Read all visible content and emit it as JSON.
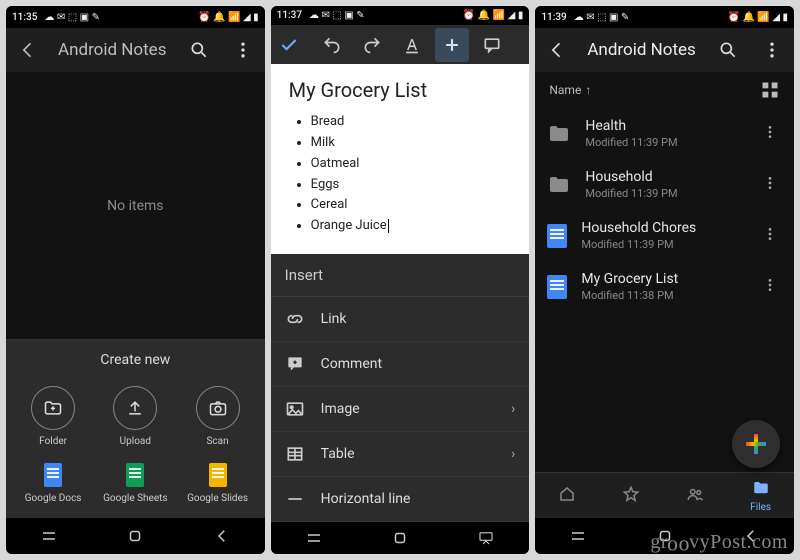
{
  "watermark": "groovyPost.com",
  "phone1": {
    "status": {
      "time": "11:35"
    },
    "appbar": {
      "title": "Android Notes"
    },
    "body": {
      "empty_text": "No items"
    },
    "sheet": {
      "title": "Create new",
      "items": [
        {
          "label": "Folder",
          "icon": "folder-plus"
        },
        {
          "label": "Upload",
          "icon": "upload"
        },
        {
          "label": "Scan",
          "icon": "camera"
        },
        {
          "label": "Google Docs",
          "icon": "docs",
          "color": "#4285f4"
        },
        {
          "label": "Google Sheets",
          "icon": "sheets",
          "color": "#0f9d58"
        },
        {
          "label": "Google Slides",
          "icon": "slides",
          "color": "#f4b400"
        }
      ]
    }
  },
  "phone2": {
    "status": {
      "time": "11:37"
    },
    "document": {
      "title": "My Grocery List",
      "items": [
        "Bread",
        "Milk",
        "Oatmeal",
        "Eggs",
        "Cereal",
        "Orange Juice"
      ]
    },
    "insert": {
      "header": "Insert",
      "rows": [
        {
          "label": "Link",
          "icon": "link",
          "chevron": false
        },
        {
          "label": "Comment",
          "icon": "comment",
          "chevron": false
        },
        {
          "label": "Image",
          "icon": "image",
          "chevron": true
        },
        {
          "label": "Table",
          "icon": "table",
          "chevron": true
        },
        {
          "label": "Horizontal line",
          "icon": "hr",
          "chevron": false
        }
      ]
    }
  },
  "phone3": {
    "status": {
      "time": "11:39"
    },
    "appbar": {
      "title": "Android Notes"
    },
    "sort": {
      "label": "Name",
      "direction": "asc"
    },
    "files": [
      {
        "name": "Health",
        "sub": "Modified 11:39 PM",
        "type": "folder"
      },
      {
        "name": "Household",
        "sub": "Modified 11:39 PM",
        "type": "folder"
      },
      {
        "name": "Household Chores",
        "sub": "Modified 11:39 PM",
        "type": "doc"
      },
      {
        "name": "My Grocery List",
        "sub": "Modified 11:38 PM",
        "type": "doc"
      }
    ],
    "tabs": [
      {
        "label": "Home",
        "icon": "home",
        "active": false
      },
      {
        "label": "Starred",
        "icon": "star",
        "active": false
      },
      {
        "label": "Shared",
        "icon": "people",
        "active": false
      },
      {
        "label": "Files",
        "icon": "folder",
        "active": true
      }
    ]
  }
}
